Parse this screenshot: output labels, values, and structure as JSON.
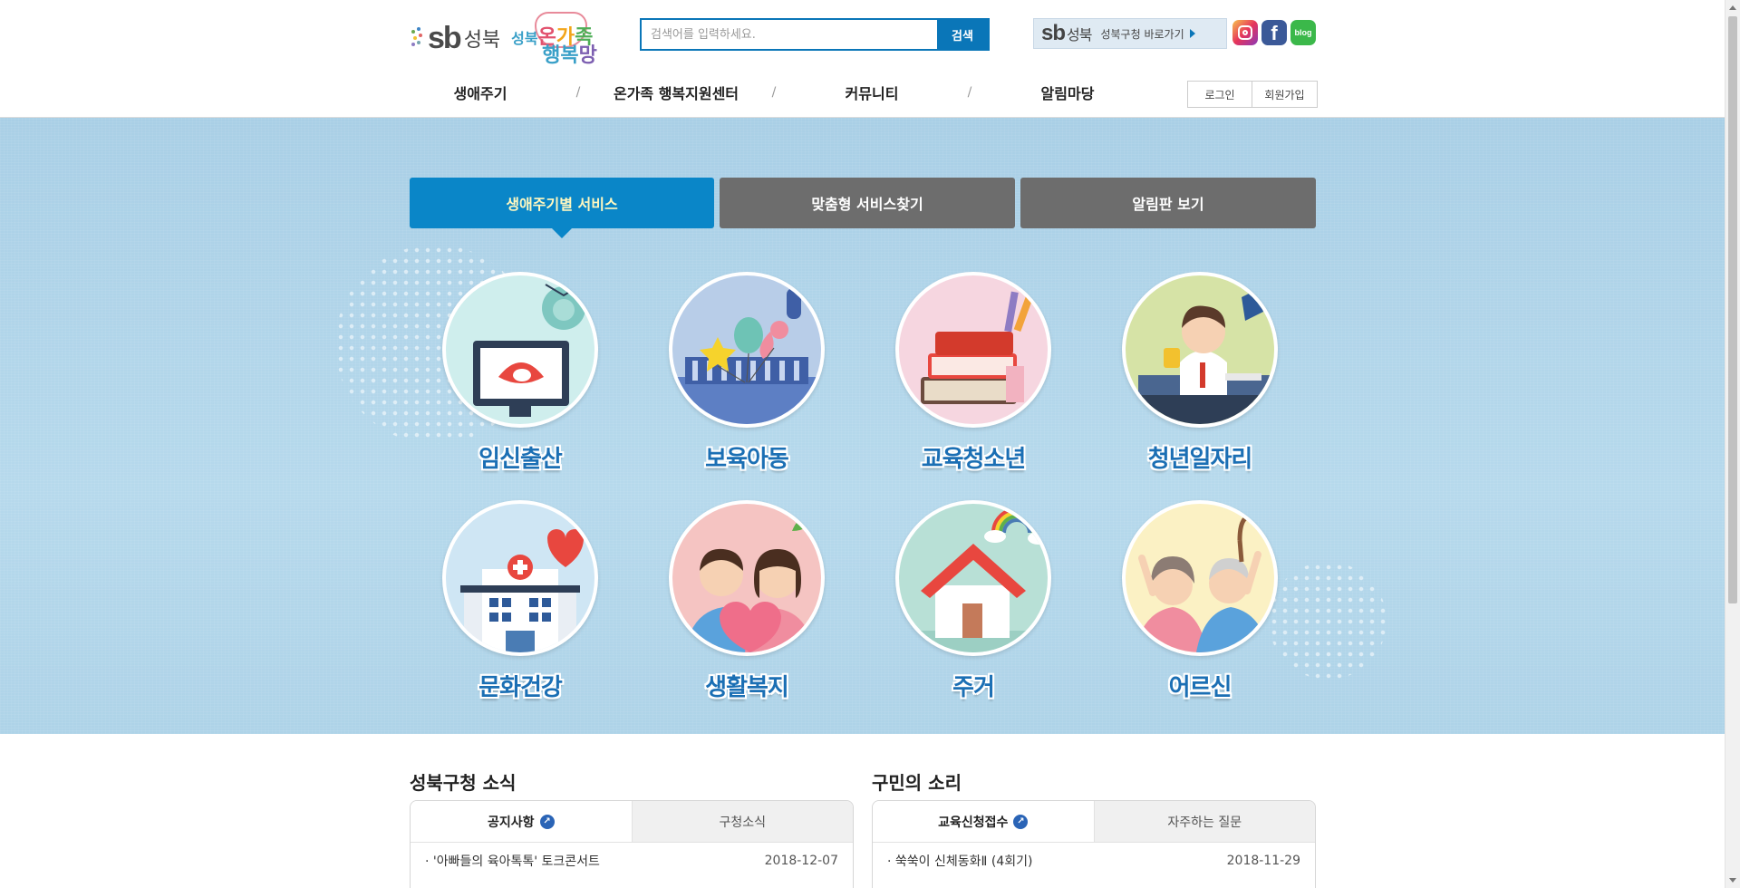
{
  "header": {
    "logo_sb": "sb",
    "logo_district": "성북",
    "slogan": {
      "a": "성북",
      "b": "온",
      "c": "가",
      "d": "족",
      "e": "행복",
      "f": "망"
    },
    "search": {
      "placeholder": "검색어를 입력하세요.",
      "value": "",
      "button": "검색"
    },
    "gov_link": {
      "logo": "sb",
      "logo_district": "성북",
      "label": "성북구청 바로가기"
    },
    "sns": {
      "instagram": "instagram-icon",
      "facebook": "f",
      "blog": "blog"
    },
    "nav": [
      "생애주기",
      "온가족 행복지원센터",
      "커뮤니티",
      "알림마당"
    ],
    "nav_separator": "/",
    "auth": {
      "login": "로그인",
      "join": "회원가입"
    }
  },
  "hero": {
    "tabs": [
      "생애주기별 서비스",
      "맞춤형 서비스찾기",
      "알림판 보기"
    ],
    "active_tab": 0,
    "services": [
      {
        "label": "임신출산",
        "icon": "ultrasound-monitor-icon"
      },
      {
        "label": "보육아동",
        "icon": "crib-balloons-icon"
      },
      {
        "label": "교육청소년",
        "icon": "books-icon"
      },
      {
        "label": "청년일자리",
        "icon": "student-desk-icon"
      },
      {
        "label": "문화건강",
        "icon": "hospital-icon"
      },
      {
        "label": "생활복지",
        "icon": "couple-heart-icon"
      },
      {
        "label": "주거",
        "icon": "house-rainbow-icon"
      },
      {
        "label": "어르신",
        "icon": "elderly-couple-icon"
      }
    ]
  },
  "news": {
    "left": {
      "title": "성북구청 소식",
      "tabs": [
        "공지사항",
        "구청소식"
      ],
      "items": [
        {
          "text": "· '아빠들의 육아톡톡' 토크콘서트",
          "date": "2018-12-07"
        }
      ]
    },
    "right": {
      "title": "구민의 소리",
      "tabs": [
        "교육신청접수",
        "자주하는 질문"
      ],
      "items": [
        {
          "text": "· 쑥쑥이 신체동화Ⅱ (4회기)",
          "date": "2018-11-29"
        }
      ]
    }
  },
  "colors": {
    "primary": "#0a86c8",
    "tab_inactive": "#6d6d6d",
    "label": "#1b6fb4",
    "hero_bg": "#b0d5ea"
  }
}
